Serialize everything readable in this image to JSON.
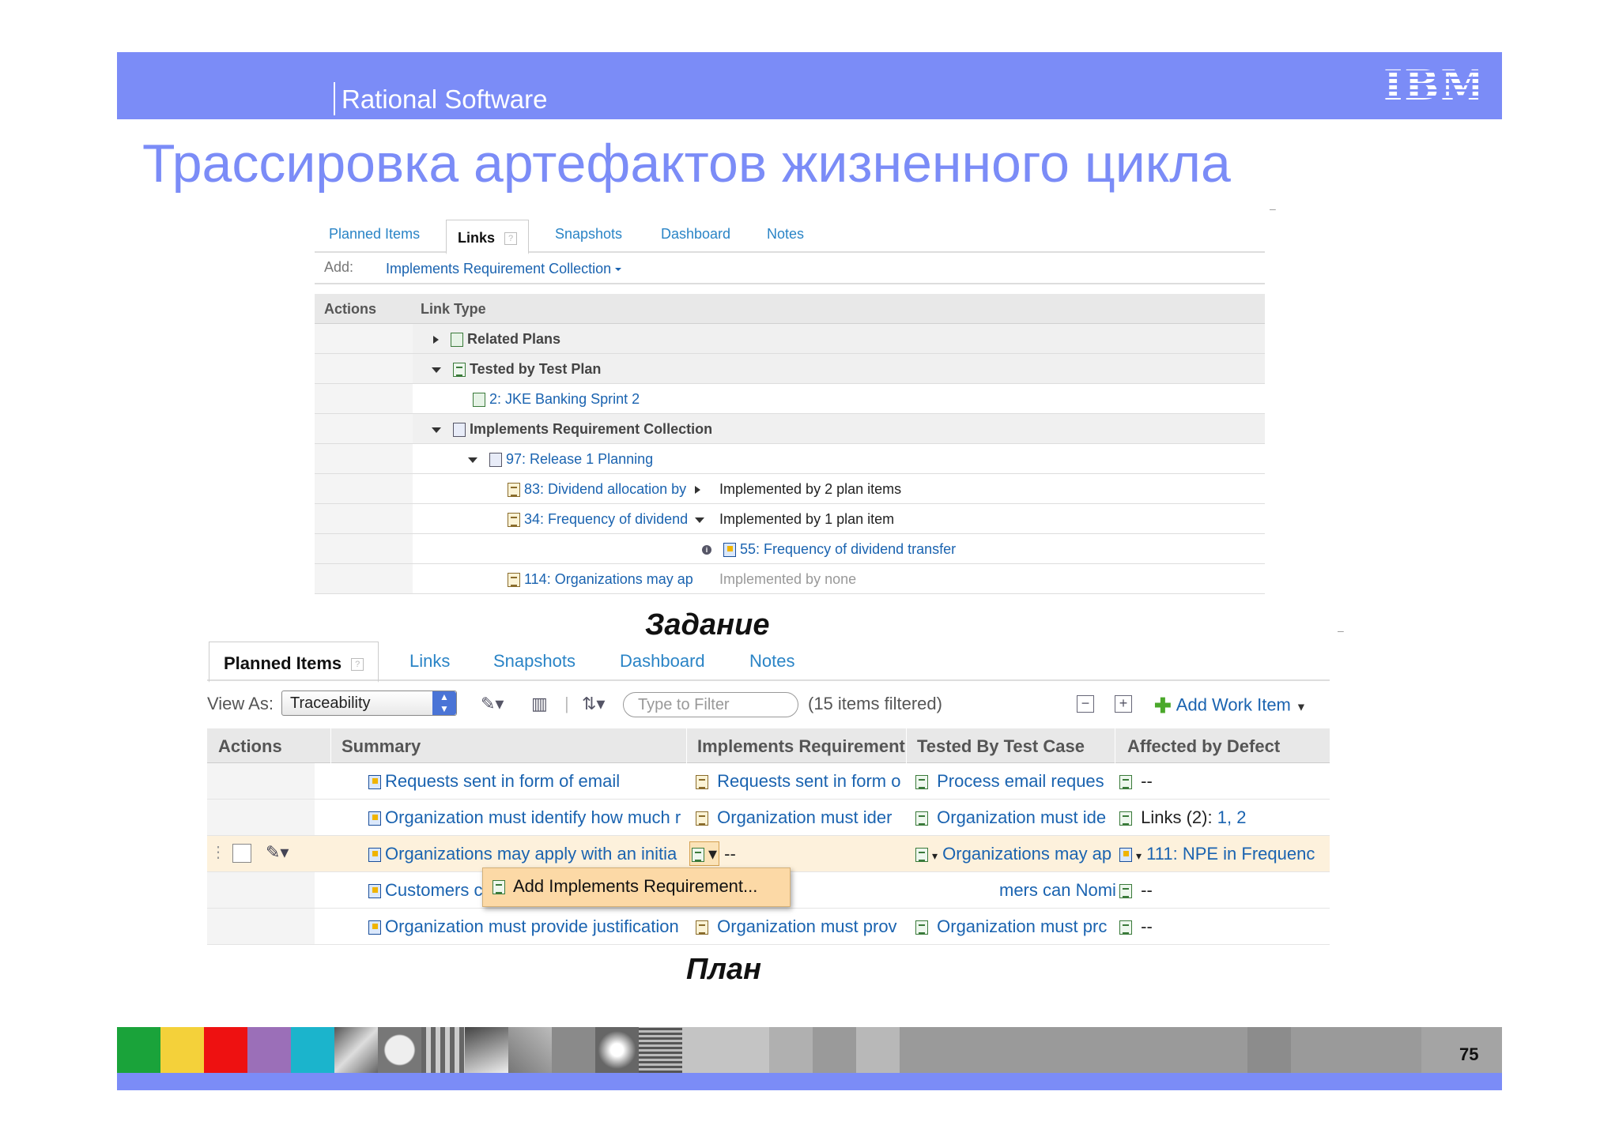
{
  "header": {
    "brand": "Rational Software",
    "logo": "IBM"
  },
  "title": "Трассировка артефактов жизненного цикла",
  "captions": {
    "task": "Задание",
    "plan": "План"
  },
  "page_number": "75",
  "links_panel": {
    "tabs": [
      "Planned Items",
      "Links",
      "Snapshots",
      "Dashboard",
      "Notes"
    ],
    "active_tab": "Links",
    "add_label": "Add:",
    "add_value": "Implements Requirement Collection",
    "columns": {
      "actions": "Actions",
      "link_type": "Link Type"
    },
    "rows": [
      {
        "text": "Related Plans"
      },
      {
        "text": "Tested by Test Plan"
      },
      {
        "text": "2: JKE Banking Sprint 2"
      },
      {
        "text": "Implements Requirement Collection"
      },
      {
        "text": "97: Release 1 Planning"
      },
      {
        "text": "83: Dividend allocation by",
        "status": "Implemented by 2 plan items"
      },
      {
        "text": "34: Frequency of dividend",
        "status": "Implemented by 1 plan item"
      },
      {
        "text": "55: Frequency of dividend transfer"
      },
      {
        "text": "114: Organizations may ap",
        "status": "Implemented by none"
      }
    ]
  },
  "plan_panel": {
    "tabs": [
      "Planned Items",
      "Links",
      "Snapshots",
      "Dashboard",
      "Notes"
    ],
    "active_tab": "Planned Items",
    "view_as_label": "View As:",
    "view_as_value": "Traceability",
    "filter_placeholder": "Type to Filter",
    "filtered_count": "(15 items filtered)",
    "add_work_item": "Add Work Item",
    "columns": {
      "actions": "Actions",
      "summary": "Summary",
      "implements": "Implements Requirement",
      "tested_by": "Tested By Test Case",
      "affected": "Affected by Defect"
    },
    "rows": [
      {
        "summary": "Requests sent in form of email",
        "implements": "Requests sent in form o",
        "tested": "Process email reques",
        "defect": "--"
      },
      {
        "summary": "Organization must identify how much r",
        "implements": "Organization must ider",
        "tested": "Organization must ide",
        "defect_label": "Links (2):",
        "defect_links": "1, 2"
      },
      {
        "summary": "Organizations may apply with an initia",
        "implements": "--",
        "tested": "Organizations may ap",
        "defect": "111: NPE in Frequenc"
      },
      {
        "summary": "Customers can Nominate an Organiza",
        "implements": "",
        "tested": "mers can Nomir",
        "defect": "--"
      },
      {
        "summary": "Organization must provide justification",
        "implements": "Organization must prov",
        "tested": "Organization must prc",
        "defect": "--"
      }
    ],
    "context_menu": "Add Implements Requirement..."
  },
  "footer_colors": [
    "#1aa33a",
    "#f4d13a",
    "#ee1111",
    "#9b6fb8",
    "#1bb4cc"
  ]
}
